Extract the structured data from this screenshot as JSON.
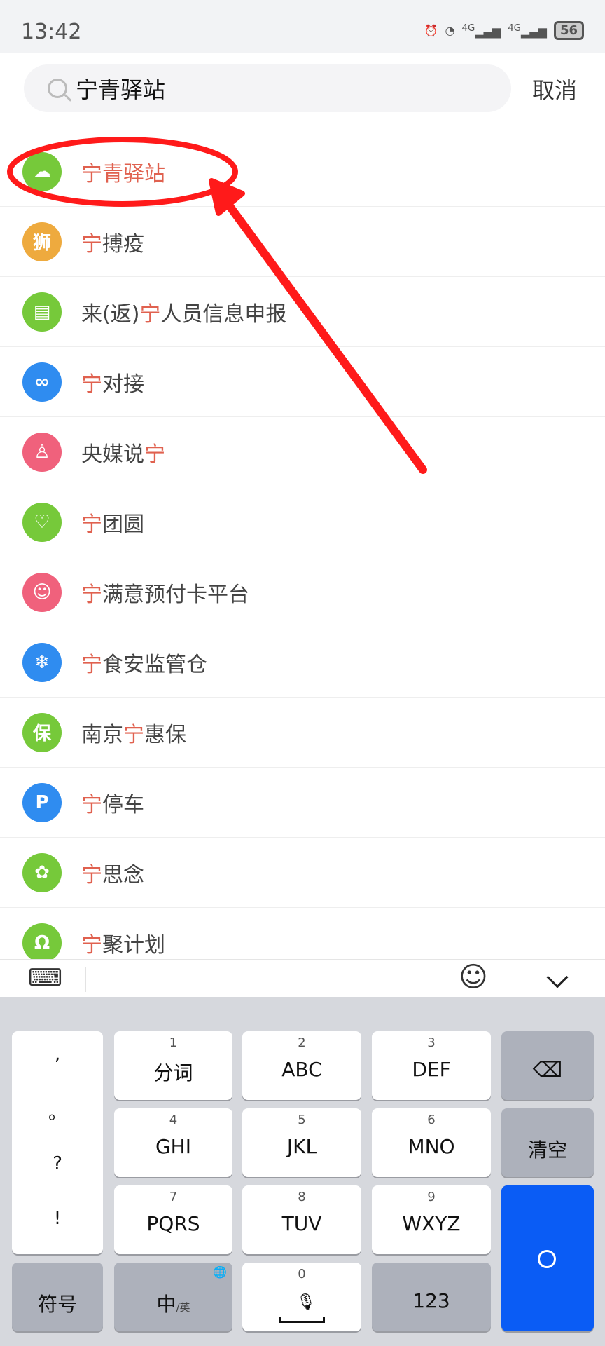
{
  "status": {
    "time": "13:42",
    "battery": "56",
    "net1": "4G",
    "net2": "4G"
  },
  "search": {
    "value": "宁青驿站",
    "cancel": "取消"
  },
  "results": [
    {
      "pre": "",
      "hl": "宁",
      "post": "青驿站",
      "color": "#76c93a",
      "glyph": "☁",
      "all_hl": true
    },
    {
      "pre": "",
      "hl": "宁",
      "post": "搏疫",
      "color": "#eeaa3e",
      "glyph": "狮"
    },
    {
      "pre": "来(返)",
      "hl": "宁",
      "post": "人员信息申报",
      "color": "#76c93a",
      "glyph": "▤"
    },
    {
      "pre": "",
      "hl": "宁",
      "post": "对接",
      "color": "#2f8cf0",
      "glyph": "∞"
    },
    {
      "pre": "央媒说",
      "hl": "宁",
      "post": "",
      "color": "#f0617c",
      "glyph": "♙"
    },
    {
      "pre": "",
      "hl": "宁",
      "post": "团圆",
      "color": "#76c93a",
      "glyph": "♡"
    },
    {
      "pre": "",
      "hl": "宁",
      "post": "满意预付卡平台",
      "color": "#f0617c",
      "glyph": "☺"
    },
    {
      "pre": "",
      "hl": "宁",
      "post": "食安监管仓",
      "color": "#2f8cf0",
      "glyph": "❄"
    },
    {
      "pre": "南京",
      "hl": "宁",
      "post": "惠保",
      "color": "#76c93a",
      "glyph": "保"
    },
    {
      "pre": "",
      "hl": "宁",
      "post": "停车",
      "color": "#2f8cf0",
      "glyph": "P"
    },
    {
      "pre": "",
      "hl": "宁",
      "post": "思念",
      "color": "#76c93a",
      "glyph": "✿"
    },
    {
      "pre": "",
      "hl": "宁",
      "post": "聚计划",
      "color": "#76c93a",
      "glyph": "Ω"
    }
  ],
  "keyboard": {
    "punct": [
      ",",
      "。",
      "?",
      "!"
    ],
    "keys": [
      {
        "num": "1",
        "label": "分词"
      },
      {
        "num": "2",
        "label": "ABC"
      },
      {
        "num": "3",
        "label": "DEF"
      },
      {
        "num": "4",
        "label": "GHI"
      },
      {
        "num": "5",
        "label": "JKL"
      },
      {
        "num": "6",
        "label": "MNO"
      },
      {
        "num": "7",
        "label": "PQRS"
      },
      {
        "num": "8",
        "label": "TUV"
      },
      {
        "num": "9",
        "label": "WXYZ"
      }
    ],
    "clear": "清空",
    "symbols": "符号",
    "lang": "中",
    "lang_sub": "/英",
    "zero": "0",
    "num123": "123"
  },
  "colors": {
    "highlight": "#e0614f",
    "search_key": "#0a5cf5",
    "annotation": "#ff1a1a"
  }
}
